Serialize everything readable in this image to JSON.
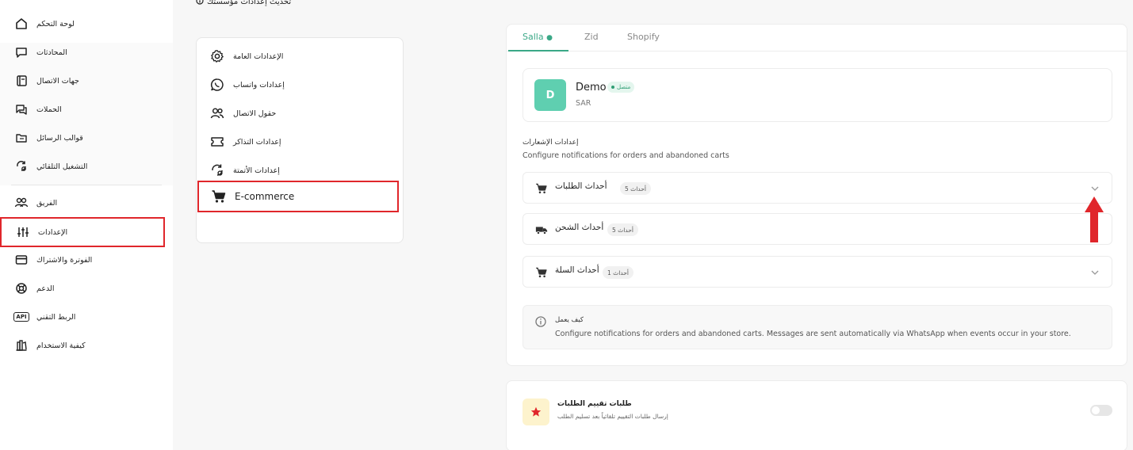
{
  "nav": {
    "items": [
      {
        "label": "لوحة التحكم",
        "icon": "home-icon"
      },
      {
        "label": "المحادثات",
        "icon": "chat-icon"
      },
      {
        "label": "جهات الاتصال",
        "icon": "contacts-icon"
      },
      {
        "label": "الحملات",
        "icon": "campaigns-icon"
      },
      {
        "label": "قوالب الرسائل",
        "icon": "templates-icon"
      },
      {
        "label": "التشغيل التلقائي",
        "icon": "automation-icon"
      },
      {
        "label": "الفريق",
        "icon": "team-icon"
      },
      {
        "label": "الإعدادات",
        "icon": "settings-sliders-icon"
      },
      {
        "label": "الفوترة والاشتراك",
        "icon": "billing-icon"
      },
      {
        "label": "الدعم",
        "icon": "support-icon"
      },
      {
        "label": "الربط التقني",
        "icon": "api-icon"
      },
      {
        "label": "كيفية الاستخدام",
        "icon": "guide-icon"
      }
    ],
    "api_badge": "API"
  },
  "top_hint": "تحديث إعدادات مؤسستك",
  "settings_menu": {
    "items": [
      {
        "label": "الإعدادات العامة",
        "icon": "gear-icon"
      },
      {
        "label": "إعدادات واتساب",
        "icon": "whatsapp-icon"
      },
      {
        "label": "حقول الاتصال",
        "icon": "users-icon"
      },
      {
        "label": "إعدادات التذاكر",
        "icon": "ticket-icon"
      },
      {
        "label": "إعدادات الأتمتة",
        "icon": "automation-icon"
      },
      {
        "label": "E-commerce",
        "icon": "cart-icon"
      }
    ]
  },
  "main": {
    "tabs": [
      "Salla",
      "Zid",
      "Shopify"
    ],
    "store": {
      "avatar_letter": "D",
      "name": "Demo",
      "badge": "متصل",
      "currency": "SAR"
    },
    "notifications": {
      "title": "إعدادات الإشعارات",
      "subtitle": "Configure notifications for orders and abandoned carts"
    },
    "accordions": [
      {
        "title": "أحداث الطلبات",
        "count": "5 أحداث",
        "icon": "cart-icon"
      },
      {
        "title": "أحداث الشحن",
        "count": "5 أحداث",
        "icon": "truck-icon"
      },
      {
        "title": "أحداث السلة",
        "count": "1 أحداث",
        "icon": "cart-icon"
      }
    ],
    "info": {
      "title": "كيف يعمل",
      "text": "Configure notifications for orders and abandoned carts. Messages are sent automatically via WhatsApp when events occur in your store."
    }
  },
  "review": {
    "title": "طلبات تقييم الطلبات",
    "subtitle": "إرسال طلبات التقييم تلقائياً بعد تسليم الطلب"
  },
  "colors": {
    "accent": "#3aa887",
    "highlight": "#e0262b",
    "avatar": "#5fcfb0"
  }
}
